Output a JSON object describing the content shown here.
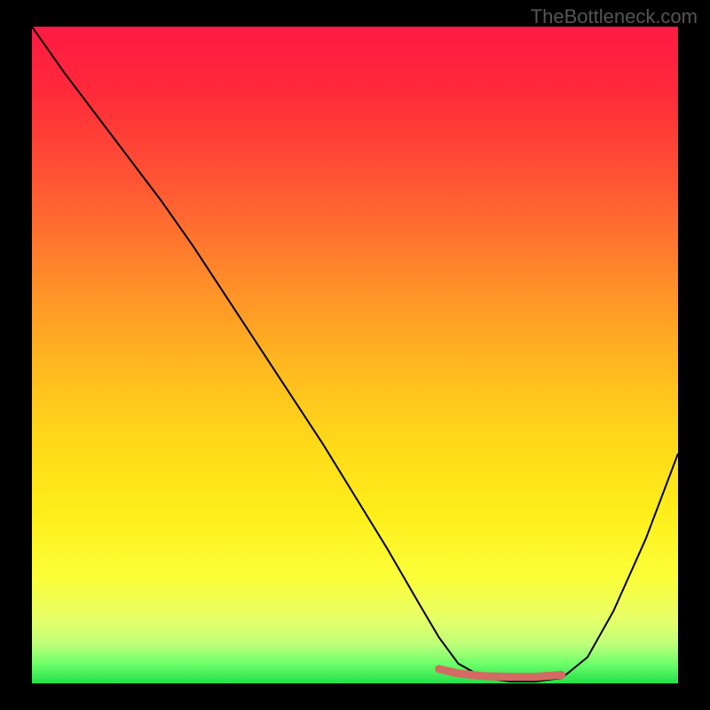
{
  "watermark": "TheBottleneck.com",
  "chart_data": {
    "type": "line",
    "title": "",
    "xlabel": "",
    "ylabel": "",
    "xlim": [
      0,
      100
    ],
    "ylim": [
      0,
      100
    ],
    "series": [
      {
        "name": "curve",
        "x": [
          0,
          5,
          10,
          15,
          20,
          25,
          30,
          35,
          40,
          45,
          50,
          55,
          60,
          63,
          66,
          70,
          74,
          78,
          82,
          86,
          90,
          95,
          100
        ],
        "y": [
          100,
          93,
          86.5,
          80,
          73.5,
          66.5,
          59,
          51.5,
          44,
          36.5,
          28.5,
          20.5,
          12,
          7,
          3,
          0.8,
          0.3,
          0.3,
          0.8,
          4,
          11,
          22,
          35
        ]
      }
    ],
    "highlight": {
      "name": "bottom-band",
      "color": "#d36a63",
      "x": [
        63,
        66,
        70,
        74,
        78,
        82
      ],
      "y": [
        2.2,
        1.5,
        1.1,
        1.0,
        1.0,
        1.3
      ]
    },
    "gradient_stops": [
      {
        "pos": 0.0,
        "color": "#ff1a44"
      },
      {
        "pos": 0.25,
        "color": "#ff5a33"
      },
      {
        "pos": 0.5,
        "color": "#ffb321"
      },
      {
        "pos": 0.75,
        "color": "#ffee1a"
      },
      {
        "pos": 0.94,
        "color": "#bfff7a"
      },
      {
        "pos": 1.0,
        "color": "#22e04a"
      }
    ]
  }
}
